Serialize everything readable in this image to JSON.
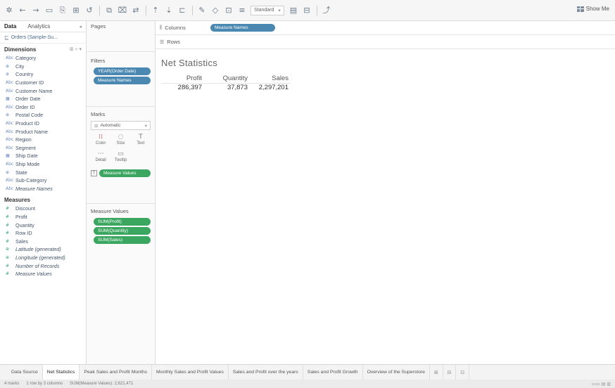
{
  "toolbar": {
    "fit_select": "Standard",
    "show_me_label": "Show Me"
  },
  "data_pane": {
    "tab_data": "Data",
    "tab_analytics": "Analytics",
    "datasource": "Orders (Sample-Su...",
    "dimensions_header": "Dimensions",
    "dimensions": [
      {
        "icon": "Abc",
        "label": "Category"
      },
      {
        "icon": "⊕",
        "label": "City"
      },
      {
        "icon": "⊕",
        "label": "Country"
      },
      {
        "icon": "Abc",
        "label": "Customer ID"
      },
      {
        "icon": "Abc",
        "label": "Customer Name"
      },
      {
        "icon": "▦",
        "label": "Order Date"
      },
      {
        "icon": "Abc",
        "label": "Order ID"
      },
      {
        "icon": "⊕",
        "label": "Postal Code"
      },
      {
        "icon": "Abc",
        "label": "Product ID"
      },
      {
        "icon": "Abc",
        "label": "Product Name"
      },
      {
        "icon": "Abc",
        "label": "Region"
      },
      {
        "icon": "Abc",
        "label": "Segment"
      },
      {
        "icon": "▦",
        "label": "Ship Date"
      },
      {
        "icon": "Abc",
        "label": "Ship Mode"
      },
      {
        "icon": "⊕",
        "label": "State"
      },
      {
        "icon": "Abc",
        "label": "Sub-Category"
      },
      {
        "icon": "Abc",
        "label": "Measure Names",
        "italic": true
      }
    ],
    "measures_header": "Measures",
    "measures": [
      {
        "icon": "#",
        "label": "Discount"
      },
      {
        "icon": "#",
        "label": "Profit"
      },
      {
        "icon": "#",
        "label": "Quantity"
      },
      {
        "icon": "#",
        "label": "Row ID"
      },
      {
        "icon": "#",
        "label": "Sales"
      },
      {
        "icon": "⊕",
        "label": "Latitude (generated)",
        "italic": true
      },
      {
        "icon": "⊕",
        "label": "Longitude (generated)",
        "italic": true
      },
      {
        "icon": "#",
        "label": "Number of Records",
        "italic": true
      },
      {
        "icon": "#",
        "label": "Measure Values",
        "italic": true
      }
    ]
  },
  "shelves": {
    "pages_label": "Pages",
    "filters_label": "Filters",
    "filters": [
      "YEAR(Order Date)",
      "Measure Names"
    ],
    "marks_label": "Marks",
    "marks_type": "Automatic",
    "marks_buttons": [
      {
        "icon": "⁞⁞",
        "label": "Color"
      },
      {
        "icon": "◌",
        "label": "Size"
      },
      {
        "icon": "T",
        "label": "Text"
      },
      {
        "icon": "⋯",
        "label": "Detail"
      },
      {
        "icon": "▭",
        "label": "Tooltip"
      }
    ],
    "marks_pill": "Measure Values",
    "measure_values_label": "Measure Values",
    "measure_values": [
      "SUM(Profit)",
      "SUM(Quantity)",
      "SUM(Sales)"
    ],
    "columns_label": "Columns",
    "columns_pill": "Measure Names",
    "rows_label": "Rows"
  },
  "view": {
    "title": "Net Statistics",
    "headers": [
      "Profit",
      "Quantity",
      "Sales"
    ],
    "values": [
      "286,397",
      "37,873",
      "2,297,201"
    ]
  },
  "sheet_tabs": [
    {
      "label": "Data Source",
      "active": false
    },
    {
      "label": "Net Statistics",
      "active": true
    },
    {
      "label": "Peak Sales and Profit Months",
      "active": false
    },
    {
      "label": "Monthly Sales and Profit Values",
      "active": false
    },
    {
      "label": "Sales and Profit over the years",
      "active": false
    },
    {
      "label": "Sales and Profit Growth",
      "active": false
    },
    {
      "label": "Overview of the Superstore",
      "active": false
    }
  ],
  "status_bar": {
    "marks": "4 marks",
    "dims": "1 row by 3 columns",
    "sum": "SUM(Measure Values): 2,621,471"
  }
}
